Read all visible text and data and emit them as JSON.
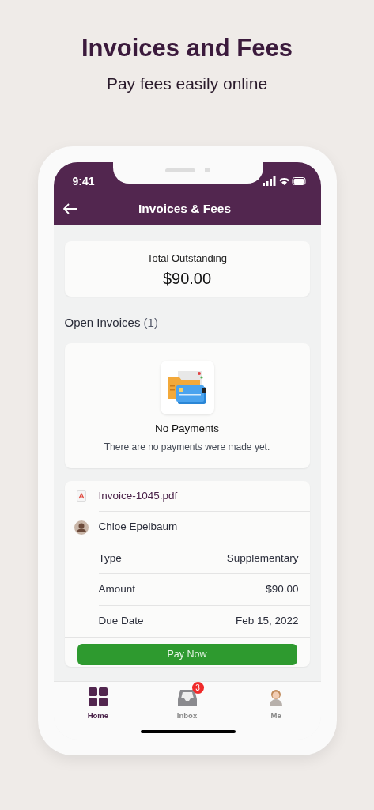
{
  "header": {
    "headline": "Invoices and Fees",
    "subtitle": "Pay fees easily online"
  },
  "status_bar": {
    "time": "9:41"
  },
  "nav": {
    "title": "Invoices & Fees"
  },
  "summary": {
    "label": "Total Outstanding",
    "amount": "$90.00"
  },
  "section": {
    "title": "Open Invoices",
    "count": "(1)"
  },
  "empty_state": {
    "title": "No Payments",
    "message": "There are no payments were made yet."
  },
  "invoice": {
    "file": "Invoice-1045.pdf",
    "person": "Chloe Epelbaum",
    "details": [
      {
        "label": "Type",
        "value": "Supplementary"
      },
      {
        "label": "Amount",
        "value": "$90.00"
      },
      {
        "label": "Due Date",
        "value": "Feb 15, 2022"
      }
    ],
    "button": "Pay Now"
  },
  "tabs": [
    {
      "label": "Home",
      "kind": "grid",
      "selected": true
    },
    {
      "label": "Inbox",
      "kind": "inbox",
      "selected": false,
      "badge": "3"
    },
    {
      "label": "Me",
      "kind": "avatar",
      "selected": false
    }
  ]
}
